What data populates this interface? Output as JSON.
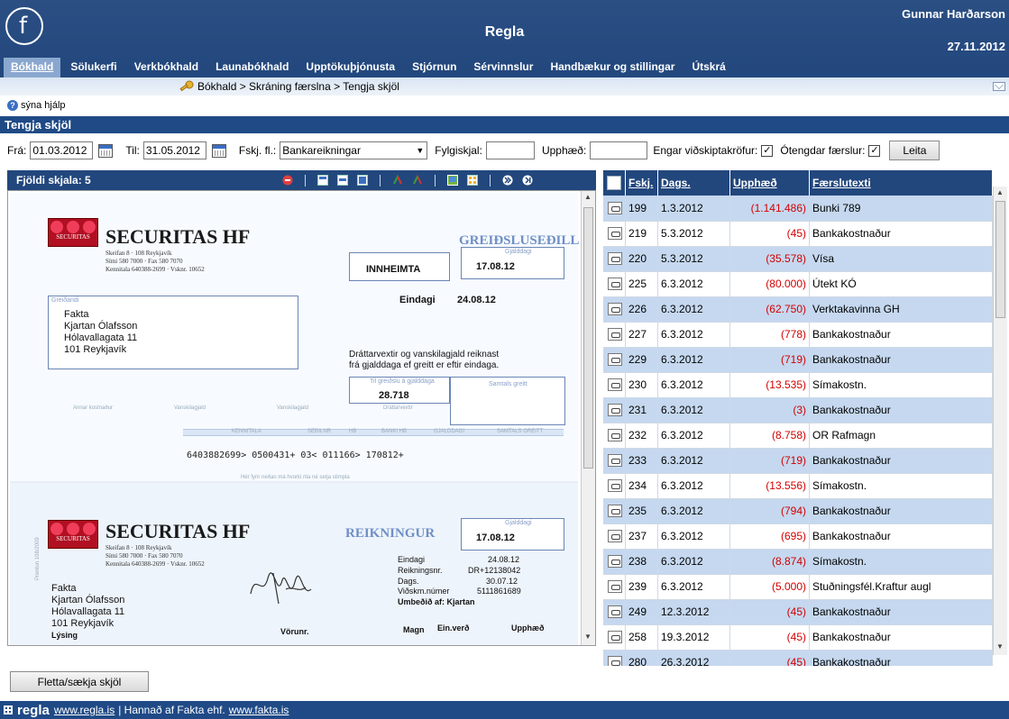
{
  "header": {
    "app_title": "Regla",
    "user_name": "Gunnar Harðarson",
    "date": "27.11.2012",
    "nav": [
      "Bókhald",
      "Sölukerfi",
      "Verkbókhald",
      "Launabókhald",
      "Upptökuþjónusta",
      "Stjórnun",
      "Sérvinnslur",
      "Handbækur og stillingar",
      "Útskrá"
    ]
  },
  "breadcrumb": "Bókhald > Skráning færslna > Tengja skjöl",
  "help_label": "sýna hjálp",
  "section_title": "Tengja skjöl",
  "filters": {
    "from_label": "Frá:",
    "from_value": "01.03.2012",
    "to_label": "Til:",
    "to_value": "31.05.2012",
    "fskj_label": "Fskj. fl.:",
    "fskj_value": "Bankareikningar",
    "fylgiskjal_label": "Fylgiskjal:",
    "fylgiskjal_value": "",
    "upphaed_label": "Upphæð:",
    "upphaed_value": "",
    "engar_label": "Engar viðskiptakröfur:",
    "engar_checked": "✓",
    "otengdar_label": "Ótengdar færslur:",
    "otengdar_checked": "✓",
    "search_button": "Leita"
  },
  "viewer": {
    "title": "Fjöldi skjala: 5",
    "doc": {
      "company": "SECURITAS HF",
      "logo_text": "SECURITAS",
      "address_line1": "Skeifan 8 · 108 Reykjavík",
      "address_line2": "Sími 580 7000 · Fax 580 7070",
      "address_line3": "Kennitala 640388-2699 · Vsknr. 10652",
      "slip_title": "GREIÐSLUSEÐILL",
      "collect_label": "INNHEIMTA",
      "gjalddagi_label": "Gjalddagi",
      "gjalddagi_value": "17.08.12",
      "eindagi_label": "Eindagi",
      "eindagi_value": "24.08.12",
      "greidandi_label": "Greiðandi",
      "recipient": [
        "Fakta",
        "Kjartan Ólafsson",
        "Hólavallagata 11",
        "101 Reykjavík"
      ],
      "interest_text1": "Dráttarvextir og vanskilagjald reiknast",
      "interest_text2": "frá gjalddaga ef greitt er eftir eindaga.",
      "amount_label": "Til greiðslu á gjalddaga",
      "amount_value": "28.718",
      "amount_side_label": "Samtals greitt",
      "strip_labels": [
        "Annar kostnaður",
        "Vanskilagjald",
        "Vanskilagjald",
        "Dráttarvextir"
      ],
      "code_labels": [
        "KENNITALA",
        "SEÐILNR",
        "HB",
        "BANKI HB",
        "GJALDDAGI",
        "SAMTALS GREITT"
      ],
      "ocr_line": "6403882699> 0500431+ 03< 011166> 170812+",
      "faint_note": "Hér fyrir neðan má hvorki rita né setja stimpla",
      "invoice_title": "REIKNINGUR",
      "invoice_gjalddagi_value": "17.08.12",
      "invoice_fields": [
        {
          "label": "Eindagi",
          "value": "24.08.12"
        },
        {
          "label": "Reikningsnr.",
          "value": "DR+12138042"
        },
        {
          "label": "Dags.",
          "value": "30.07.12"
        },
        {
          "label": "Viðskm.númer",
          "value": "5111861689"
        }
      ],
      "umbeðid": "Umbeðið af: Kjartan",
      "col_lysing": "Lýsing",
      "col_vorunr": "Vörunr.",
      "col_magn": "Magn",
      "col_einverd": "Ein.verð",
      "col_upphaed": "Upphæð",
      "side_note": "Prentun 108/2009"
    }
  },
  "table": {
    "headers": [
      "Fskj.",
      "Dags.",
      "Upphæð",
      "Færslutexti"
    ],
    "rows": [
      {
        "fskj": "199",
        "dags": "1.3.2012",
        "upphaed": "(1.141.486)",
        "texti": "Bunki 789"
      },
      {
        "fskj": "219",
        "dags": "5.3.2012",
        "upphaed": "(45)",
        "texti": "Bankakostnaður"
      },
      {
        "fskj": "220",
        "dags": "5.3.2012",
        "upphaed": "(35.578)",
        "texti": "Vísa"
      },
      {
        "fskj": "225",
        "dags": "6.3.2012",
        "upphaed": "(80.000)",
        "texti": "Útekt KÓ"
      },
      {
        "fskj": "226",
        "dags": "6.3.2012",
        "upphaed": "(62.750)",
        "texti": "Verktakavinna GH"
      },
      {
        "fskj": "227",
        "dags": "6.3.2012",
        "upphaed": "(778)",
        "texti": "Bankakostnaður"
      },
      {
        "fskj": "229",
        "dags": "6.3.2012",
        "upphaed": "(719)",
        "texti": "Bankakostnaður"
      },
      {
        "fskj": "230",
        "dags": "6.3.2012",
        "upphaed": "(13.535)",
        "texti": "Símakostn."
      },
      {
        "fskj": "231",
        "dags": "6.3.2012",
        "upphaed": "(3)",
        "texti": "Bankakostnaður"
      },
      {
        "fskj": "232",
        "dags": "6.3.2012",
        "upphaed": "(8.758)",
        "texti": "OR Rafmagn"
      },
      {
        "fskj": "233",
        "dags": "6.3.2012",
        "upphaed": "(719)",
        "texti": "Bankakostnaður"
      },
      {
        "fskj": "234",
        "dags": "6.3.2012",
        "upphaed": "(13.556)",
        "texti": "Símakostn."
      },
      {
        "fskj": "235",
        "dags": "6.3.2012",
        "upphaed": "(794)",
        "texti": "Bankakostnaður"
      },
      {
        "fskj": "237",
        "dags": "6.3.2012",
        "upphaed": "(695)",
        "texti": "Bankakostnaður"
      },
      {
        "fskj": "238",
        "dags": "6.3.2012",
        "upphaed": "(8.874)",
        "texti": "Símakostn."
      },
      {
        "fskj": "239",
        "dags": "6.3.2012",
        "upphaed": "(5.000)",
        "texti": "Stuðningsfél.Kraftur augl"
      },
      {
        "fskj": "249",
        "dags": "12.3.2012",
        "upphaed": "(45)",
        "texti": "Bankakostnaður"
      },
      {
        "fskj": "258",
        "dags": "19.3.2012",
        "upphaed": "(45)",
        "texti": "Bankakostnaður"
      },
      {
        "fskj": "280",
        "dags": "26.3.2012",
        "upphaed": "(45)",
        "texti": "Bankakostnaður"
      }
    ]
  },
  "bottom_button": "Fletta/sækja skjöl",
  "footer": {
    "brand": "regla",
    "link1": "www.regla.is",
    "separator_text": "| Hannað af Fakta ehf.",
    "link2": "www.fakta.is"
  }
}
